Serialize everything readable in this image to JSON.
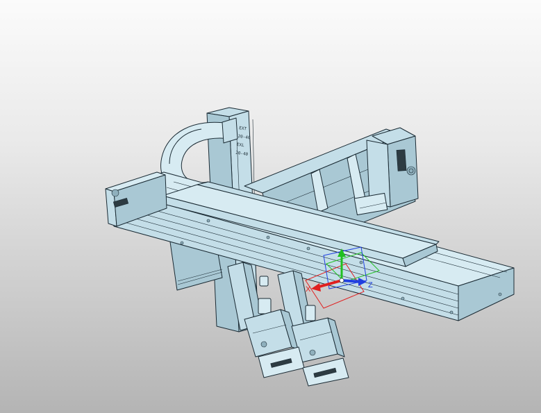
{
  "viewport": {
    "background_top": "#fbfbfb",
    "background_bottom": "#b4b4b4",
    "model_color": "#c4dee8",
    "edge_color": "#1a2a33"
  },
  "triad": {
    "x_label": "X",
    "z_label": "Z",
    "x_color": "#e02020",
    "y_color": "#20c020",
    "z_color": "#2040e0"
  },
  "labels": {
    "plate_line1": "EXT",
    "plate_line2": "20-40",
    "plate_line3": "EXL",
    "plate_line4": "20-40"
  },
  "icons": [
    "cad-model",
    "coordinate-triad"
  ]
}
